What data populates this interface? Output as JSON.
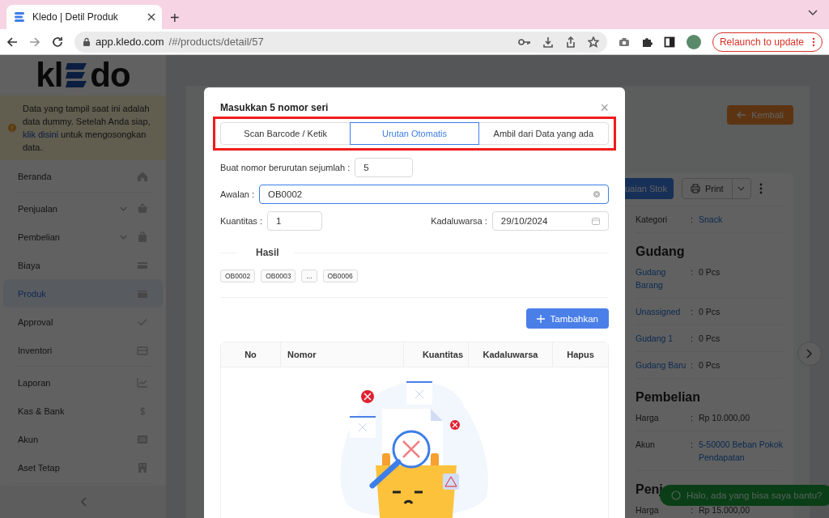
{
  "browser": {
    "tab_title": "Kledo | Detil Produk",
    "new_tab": "+",
    "url_host": "app.kledo.com",
    "url_path": "/#/products/detail/57",
    "relaunch": "Relaunch to update"
  },
  "sidebar": {
    "logo": {
      "left": "kl",
      "right": "do"
    },
    "notice": {
      "before": "Data yang tampil saat ini adalah data dummy. Setelah Anda siap,",
      "link": "klik disini",
      "after": "untuk mengosongkan data."
    },
    "groups": [
      [
        {
          "label": "Beranda",
          "expandable": false,
          "selected": false
        }
      ],
      [
        {
          "label": "Penjualan",
          "expandable": true,
          "selected": false
        },
        {
          "label": "Pembelian",
          "expandable": true,
          "selected": false
        },
        {
          "label": "Biaya",
          "expandable": false,
          "selected": false
        },
        {
          "label": "Produk",
          "expandable": false,
          "selected": true
        },
        {
          "label": "Approval",
          "expandable": false,
          "selected": false
        },
        {
          "label": "Inventori",
          "expandable": false,
          "selected": false
        }
      ],
      [
        {
          "label": "Laporan",
          "expandable": false,
          "selected": false
        },
        {
          "label": "Kas & Bank",
          "expandable": false,
          "selected": false
        },
        {
          "label": "Akun",
          "expandable": false,
          "selected": false
        },
        {
          "label": "Aset Tetap",
          "expandable": false,
          "selected": false
        }
      ]
    ]
  },
  "detail": {
    "back_button": "Kembali",
    "adjust_button": "uaian Stok",
    "print_button": "Print",
    "rows": [
      {
        "label": "Kategori",
        "colon": ":",
        "value": "Snack",
        "label_link": false,
        "value_link": true
      }
    ],
    "sections": [
      {
        "title": "Gudang",
        "rows": [
          {
            "label": "Gudang Barang",
            "colon": ":",
            "value": "0 Pcs",
            "label_link": true,
            "value_link": false
          },
          {
            "label": "Unassigned",
            "colon": ":",
            "value": "0 Pcs",
            "label_link": true,
            "value_link": false
          },
          {
            "label": "Gudang 1",
            "colon": ":",
            "value": "0 Pcs",
            "label_link": true,
            "value_link": false
          },
          {
            "label": "Gudang Baru",
            "colon": ":",
            "value": "0 Pcs",
            "label_link": true,
            "value_link": false
          }
        ]
      },
      {
        "title": "Pembelian",
        "rows": [
          {
            "label": "Harga",
            "colon": ":",
            "value": "Rp 10.000,00",
            "label_link": false,
            "value_link": false
          },
          {
            "label": "Akun",
            "colon": ":",
            "value": "5-50000 Beban Pokok Pendapatan",
            "label_link": false,
            "value_link": true
          }
        ]
      },
      {
        "title": "Penj",
        "rows": [
          {
            "label": "Harga",
            "colon": ":",
            "value": "Rp 15.000,00",
            "label_link": false,
            "value_link": false
          }
        ]
      }
    ]
  },
  "chat": {
    "text": "Halo, ada yang bisa saya bantu?"
  },
  "modal": {
    "title": "Masukkan 5 nomor seri",
    "close": "×",
    "tabs_highlighted": true,
    "tabs": [
      {
        "label": "Scan Barcode / Ketik",
        "selected": false
      },
      {
        "label": "Urutan Otomatis",
        "selected": true
      },
      {
        "label": "Ambil dari Data yang ada",
        "selected": false
      }
    ],
    "count": {
      "label": "Buat nomor berurutan sejumlah :",
      "value": "5"
    },
    "prefix": {
      "label": "Awalan :",
      "value": "OB0002",
      "focused": true
    },
    "quantity": {
      "label": "Kuantitas :",
      "value": "1"
    },
    "expiry": {
      "label": "Kadaluwarsa :",
      "value": "29/10/2024"
    },
    "result_title": "Hasil",
    "results": [
      "OB0002",
      "OB0003",
      "...",
      "OB0006"
    ],
    "add_button": "Tambahkan",
    "table": {
      "columns": [
        "No",
        "Nomor",
        "Kuantitas",
        "Kadaluwarsa",
        "Hapus"
      ]
    }
  }
}
